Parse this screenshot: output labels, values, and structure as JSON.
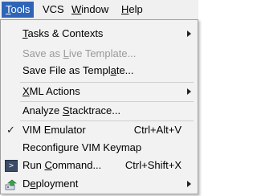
{
  "menubar": {
    "items": [
      {
        "label": "Tools",
        "mnemonic": "T",
        "rest": "ools",
        "active": true
      },
      {
        "label": "VCS"
      },
      {
        "label": "Window",
        "mnemonic": "W",
        "rest": "indow"
      },
      {
        "label": "Help",
        "mnemonic": "H",
        "rest": "elp"
      }
    ]
  },
  "menu": {
    "items": [
      {
        "pre": "",
        "u": "T",
        "post": "asks & Contexts",
        "submenu": true
      },
      {
        "pre": "Save as ",
        "u": "L",
        "post": "ive Template...",
        "disabled": true
      },
      {
        "pre": "Save File as Templ",
        "u": "a",
        "post": "te..."
      },
      {
        "pre": "",
        "u": "X",
        "post": "ML Actions",
        "submenu": true
      },
      {
        "pre": "Analyze ",
        "u": "S",
        "post": "tacktrace..."
      },
      {
        "pre": "VIM Emulator",
        "u": "",
        "post": "",
        "checked": true,
        "shortcut": "Ctrl+Alt+V"
      },
      {
        "pre": "Reconfigure VIM Keymap",
        "u": "",
        "post": ""
      },
      {
        "pre": "Run ",
        "u": "C",
        "post": "ommand...",
        "icon": "terminal-icon",
        "icon_glyph": ">",
        "shortcut": "Ctrl+Shift+X"
      },
      {
        "pre": "D",
        "u": "e",
        "post": "ployment",
        "icon": "deployment-icon",
        "submenu": true
      }
    ]
  }
}
